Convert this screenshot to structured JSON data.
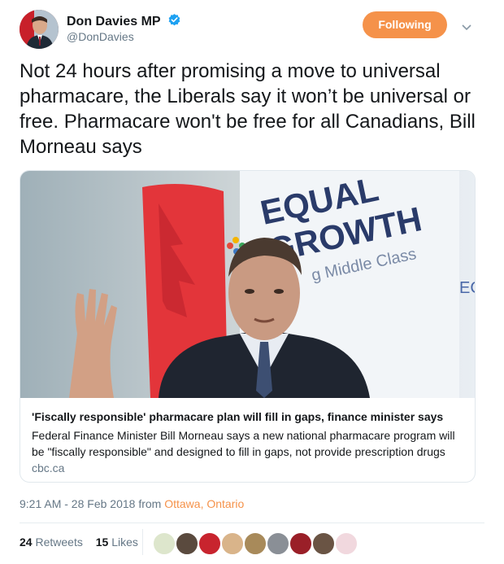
{
  "author": {
    "name": "Don Davies MP",
    "handle": "@DonDavies",
    "verified": true
  },
  "follow_button": {
    "label": "Following",
    "color": "#f5924a"
  },
  "tweet": {
    "text": "Not 24 hours after promising a move to universal pharmacare, the Liberals say it won’t be universal or free.  Pharmacare won't be free for all Canadians, Bill Morneau says"
  },
  "card": {
    "image_alt_text": "EQUAL GROWTH Middle Class",
    "title": "'Fiscally responsible' pharmacare plan will fill in gaps, finance minister says",
    "description": "Federal Finance Minister Bill Morneau says a new national pharmacare program will be \"fiscally responsible\" and designed to fill in gaps, not provide prescription drugs",
    "domain": "cbc.ca"
  },
  "meta": {
    "time": "9:21 AM - 28 Feb 2018 from ",
    "location": "Ottawa, Ontario"
  },
  "stats": {
    "retweets_count": "24",
    "retweets_label": "Retweets",
    "likes_count": "15",
    "likes_label": "Likes"
  },
  "icons": {
    "verified": "verified-badge-icon",
    "caret": "chevron-down-icon"
  },
  "colors": {
    "accent": "#f5924a",
    "verified": "#1da1f2",
    "muted": "#657786"
  }
}
